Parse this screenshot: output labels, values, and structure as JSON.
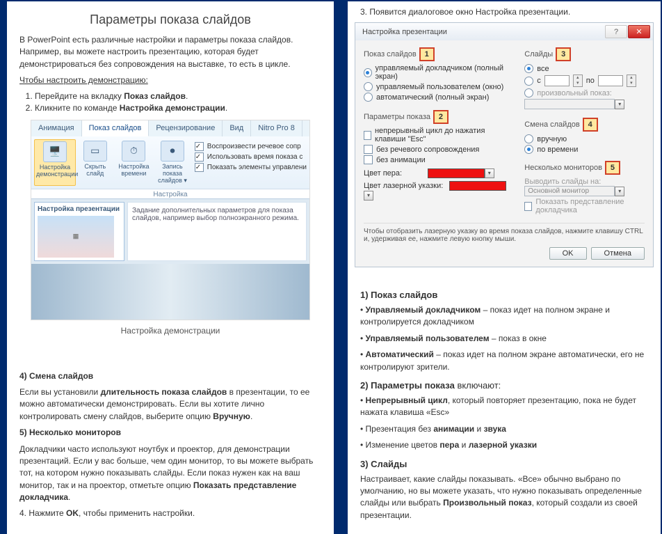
{
  "left": {
    "title": "Параметры показа слайдов",
    "intro": "В PowerPoint есть различные настройки и параметры показа слайдов. Например, вы можете настроить презентацию, которая будет демонстрироваться без сопровождения на выставке, то есть в цикле.",
    "howto": "Чтобы настроить демонстрацию:",
    "step1_a": "Перейдите на вкладку ",
    "step1_b": "Показ слайдов",
    "step1_c": ".",
    "step2_a": "Кликните по команде ",
    "step2_b": "Настройка демонстрации",
    "step2_c": ".",
    "ribbon": {
      "tabs": {
        "anim": "Анимация",
        "show": "Показ слайдов",
        "review": "Рецензирование",
        "view": "Вид",
        "nitro": "Nitro Pro 8"
      },
      "btn_setup1": "Настройка",
      "btn_setup2": "демонстрации",
      "btn_hide1": "Скрыть",
      "btn_hide2": "слайд",
      "btn_time1": "Настройка",
      "btn_time2": "времени",
      "btn_rec1": "Запись показа",
      "btn_rec2": "слайдов ▾",
      "chk1": "Воспроизвести речевое сопр",
      "chk2": "Использовать время показа с",
      "chk3": "Показать элементы управлени",
      "group": "Настройка",
      "tt_title": "Настройка презентации",
      "tt_text": "Задание дополнительных параметров для показа слайдов, например выбор полноэкранного режима."
    },
    "caption": "Настройка демонстрации",
    "sec4_h": "4) Смена слайдов",
    "sec4_a": "Если вы установили ",
    "sec4_b": "длительность показа слайдов",
    "sec4_c": " в презентации, то ее можно автоматически демонстрировать. Если вы хотите лично контролировать смену слайдов, выберите опцию ",
    "sec4_d": "Вручную",
    "sec4_e": ".",
    "sec5_h": "5) Несколько мониторов",
    "sec5_a": "Докладчики часто используют ноутбук и проектор, для демонстрации презентаций. Если у вас больше, чем один монитор, то вы можете выбрать тот, на котором нужно показывать слайды. Если показ нужен как на ваш монитор, так и на проектор, отметьте опцию ",
    "sec5_b": "Показать представление докладчика",
    "sec5_c": ".",
    "sec6_a": "4. Нажмите ",
    "sec6_b": "OK",
    "sec6_c": ", чтобы применить настройки."
  },
  "right": {
    "step3": "3.  Появится диалоговое окно Настройка презентации.",
    "dlg": {
      "title": "Настройка презентации",
      "g_show": "Показ слайдов",
      "r_full": "управляемый докладчиком (полный экран)",
      "r_win": "управляемый пользователем (окно)",
      "r_auto": "автоматический (полный экран)",
      "g_params": "Параметры показа",
      "c_loop": "непрерывный цикл до нажатия клавиши \"Esc\"",
      "c_narr": "без речевого сопровождения",
      "c_anim": "без анимации",
      "pen": "Цвет пера:",
      "laser": "Цвет лазерной указки:",
      "g_slides": "Слайды",
      "r_all": "все",
      "r_from_c": "с",
      "r_from_to": "по",
      "r_custom": "произвольный показ:",
      "g_adv": "Смена слайдов",
      "r_man": "вручную",
      "r_time": "по времени",
      "g_mon": "Несколько мониторов",
      "mon_lbl": "Выводить слайды на:",
      "mon_val": "Основной монитор",
      "c_pres": "Показать представление докладчика",
      "hint": "Чтобы отобразить лазерную указку во время показа слайдов, нажмите клавишу CTRL и, удерживая ее, нажмите левую кнопку мыши.",
      "ok": "OK",
      "cancel": "Отмена",
      "m1": "1",
      "m2": "2",
      "m3": "3",
      "m4": "4",
      "m5": "5",
      "from_val": "",
      "to_val": ""
    },
    "d1_h": "1) Показ слайдов",
    "d1a_b": "Управляемый докладчиком",
    "d1a_t": " – показ идет на полном экране и контролируется докладчиком",
    "d1b_b": "Управляемый пользователем",
    "d1b_t": " – показ в окне",
    "d1c_b": "Автоматический",
    "d1c_t": " – показ идет на полном экране автоматически, его не контролируют зрители.",
    "d2_h_a": "2) Параметры показа",
    "d2_h_b": " включают:",
    "d2a_b": "Непрерывный цикл",
    "d2a_t": ", который повторяет презентацию, пока не будет нажата клавиша «Esc»",
    "d2b_a": "Презентация без ",
    "d2b_b1": "анимации",
    "d2b_m": " и ",
    "d2b_b2": "звука",
    "d2c_a": "Изменение цветов ",
    "d2c_b1": "пера",
    "d2c_m": " и ",
    "d2c_b2": "лазерной указки",
    "d3_h": "3) Слайды",
    "d3_a": "Настраивает, какие слайды показывать. «Все» обычно выбрано по умолчанию, но вы можете указать, что нужно показывать определенные слайды или выбрать ",
    "d3_b": "Произвольный показ",
    "d3_c": ", который создали из своей презентации."
  }
}
